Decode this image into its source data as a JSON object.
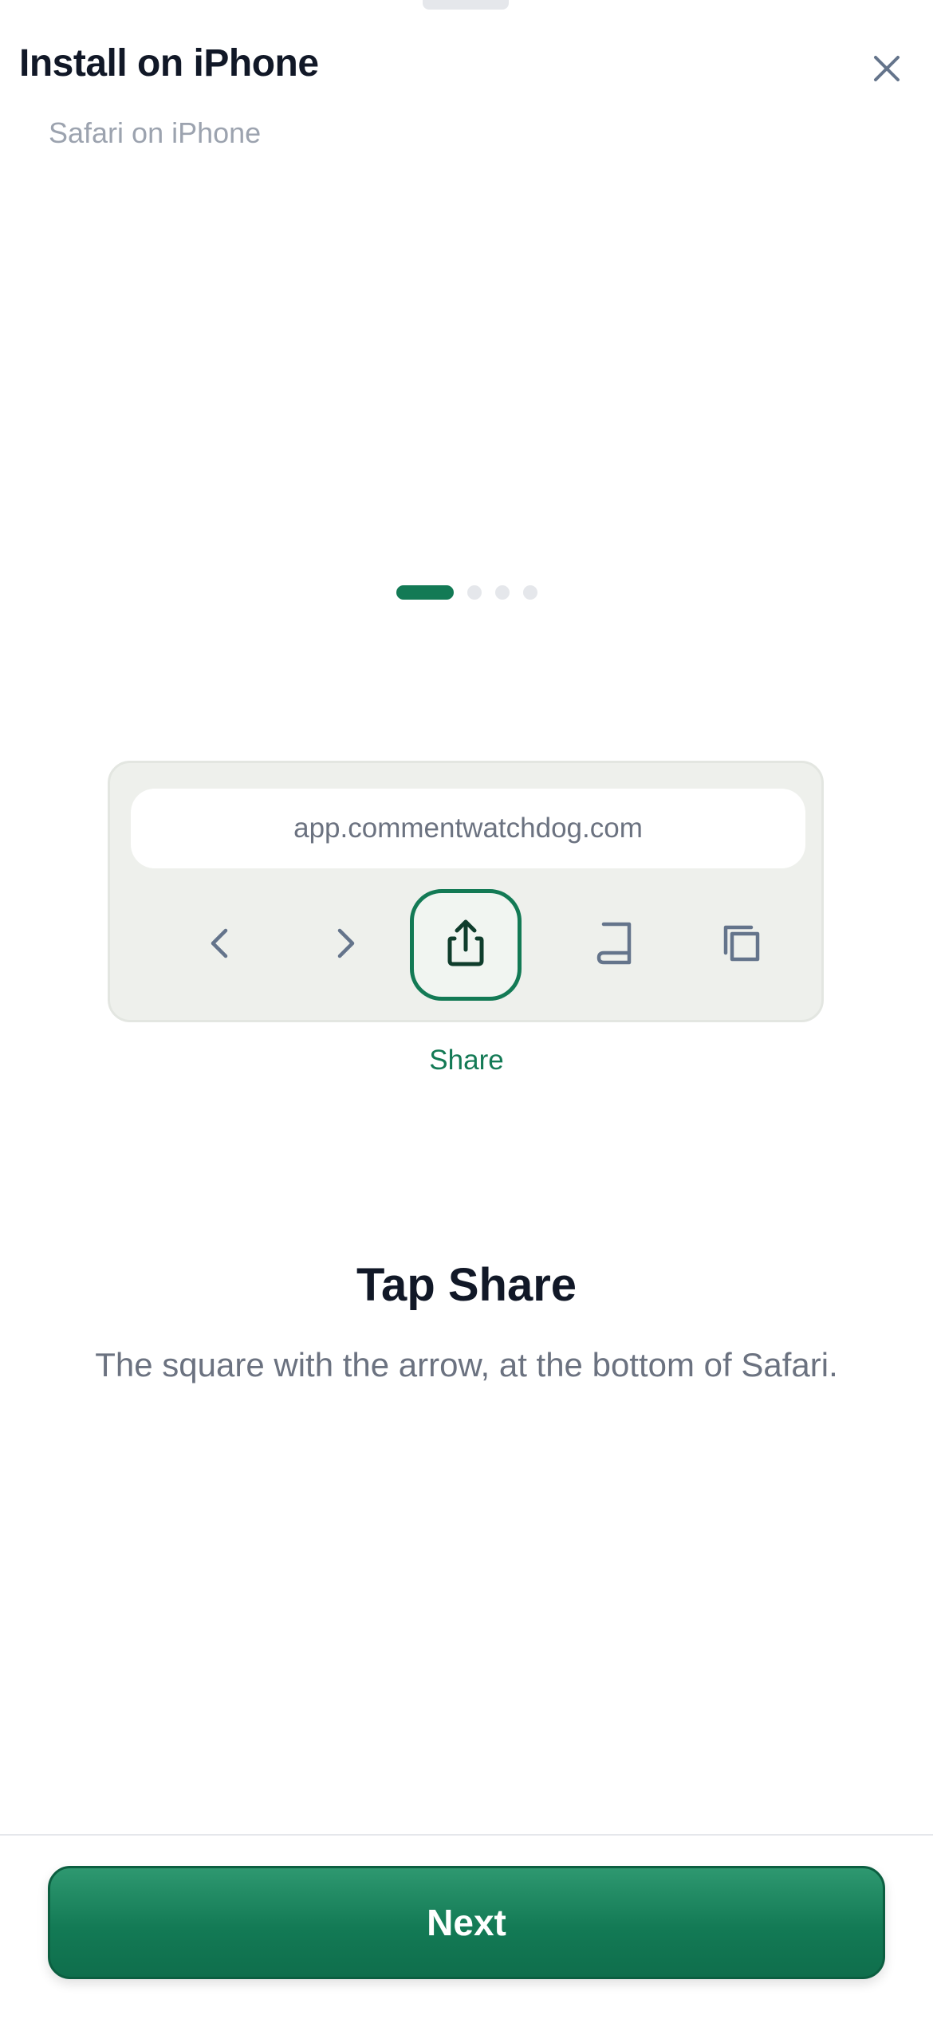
{
  "header": {
    "title": "Install on iPhone",
    "subtitle": "Safari on iPhone",
    "close_icon": "close-icon"
  },
  "pager": {
    "total": 4,
    "current": 1
  },
  "browser_mock": {
    "url": "app.commentwatchdog.com",
    "toolbar_icons": [
      "chevron-left-icon",
      "chevron-right-icon",
      "share-icon",
      "book-icon",
      "tabs-icon"
    ],
    "highlighted": "share-icon",
    "highlight_label": "Share"
  },
  "step": {
    "title": "Tap Share",
    "description": "The square with the arrow, at the bottom of Safari."
  },
  "footer": {
    "next_label": "Next"
  },
  "colors": {
    "accent": "#137a55",
    "muted_text": "#6b7280",
    "title_text": "#111827"
  }
}
